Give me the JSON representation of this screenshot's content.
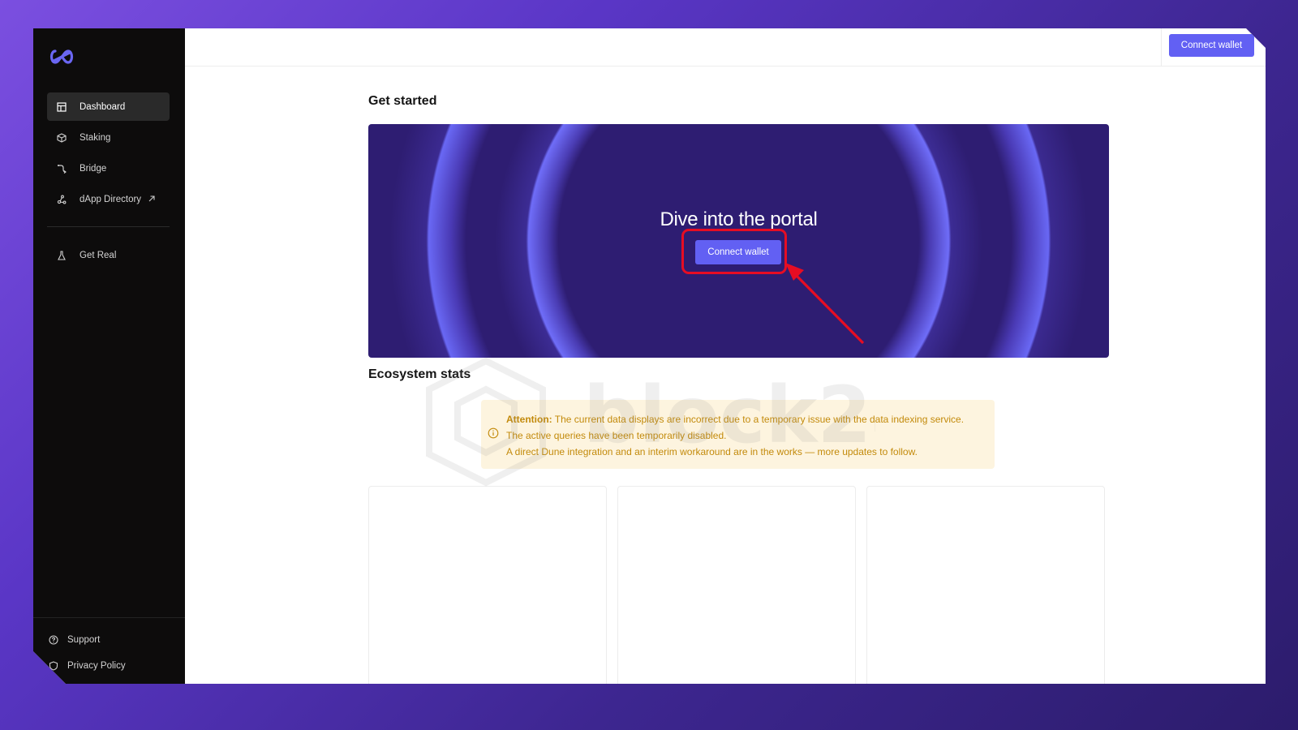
{
  "sidebar": {
    "logo_icon": "infinity-logo-icon",
    "items": [
      {
        "label": "Dashboard",
        "icon": "dashboard-icon",
        "active": true
      },
      {
        "label": "Staking",
        "icon": "cube-icon"
      },
      {
        "label": "Bridge",
        "icon": "bridge-icon"
      },
      {
        "label": "dApp Directory",
        "icon": "nodes-icon",
        "external_icon": "arrow-up-right-icon"
      },
      {
        "label": "Get Real",
        "icon": "flask-icon"
      }
    ],
    "bottom": [
      {
        "label": "Support",
        "icon": "help-circle-icon"
      },
      {
        "label": "Privacy Policy",
        "icon": "shield-icon"
      }
    ]
  },
  "topbar": {
    "connect_label": "Connect wallet"
  },
  "main": {
    "get_started_title": "Get started",
    "hero": {
      "title": "Dive into the portal",
      "connect_label": "Connect wallet",
      "highlight_color": "#e60d23"
    },
    "ecosystem_title": "Ecosystem stats",
    "notice": {
      "icon": "info-circle-icon",
      "attention_label": "Attention:",
      "line1": "The current data displays are incorrect due to a temporary issue with the data indexing service.",
      "line2": "The active queries have been temporarily disabled.",
      "line3": "A direct Dune integration and an interim workaround are in the works — more updates to follow."
    },
    "cards_count": 3
  },
  "watermark": {
    "text": "block24"
  },
  "colors": {
    "accent": "#6260f3",
    "sidebar_bg": "#0d0c0c",
    "hero_bg": "#2e1d72",
    "notice_bg": "#fdf4df",
    "notice_text": "#c38a0b"
  }
}
